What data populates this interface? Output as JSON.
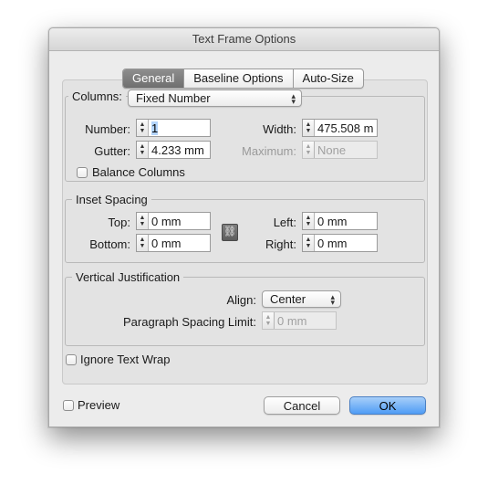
{
  "window": {
    "title": "Text Frame Options"
  },
  "tabs": [
    {
      "label": "General",
      "selected": true
    },
    {
      "label": "Baseline Options",
      "selected": false
    },
    {
      "label": "Auto-Size",
      "selected": false
    }
  ],
  "columns": {
    "label": "Columns:",
    "type_value": "Fixed Number",
    "number_label": "Number:",
    "number_value": "1",
    "width_label": "Width:",
    "width_value": "475.508 m",
    "gutter_label": "Gutter:",
    "gutter_value": "4.233 mm",
    "maximum_label": "Maximum:",
    "maximum_value": "None",
    "balance_label": "Balance Columns"
  },
  "inset": {
    "legend": "Inset Spacing",
    "top_label": "Top:",
    "top_value": "0 mm",
    "bottom_label": "Bottom:",
    "bottom_value": "0 mm",
    "left_label": "Left:",
    "left_value": "0 mm",
    "right_label": "Right:",
    "right_value": "0 mm"
  },
  "vertical": {
    "legend": "Vertical Justification",
    "align_label": "Align:",
    "align_value": "Center",
    "psl_label": "Paragraph Spacing Limit:",
    "psl_value": "0 mm"
  },
  "ignore_wrap_label": "Ignore Text Wrap",
  "footer": {
    "preview_label": "Preview",
    "cancel_label": "Cancel",
    "ok_label": "OK"
  },
  "icons": {
    "stepper": "stepper-arrows-icon",
    "chain": "chain-link-icon",
    "popup": "popup-arrows-icon"
  }
}
